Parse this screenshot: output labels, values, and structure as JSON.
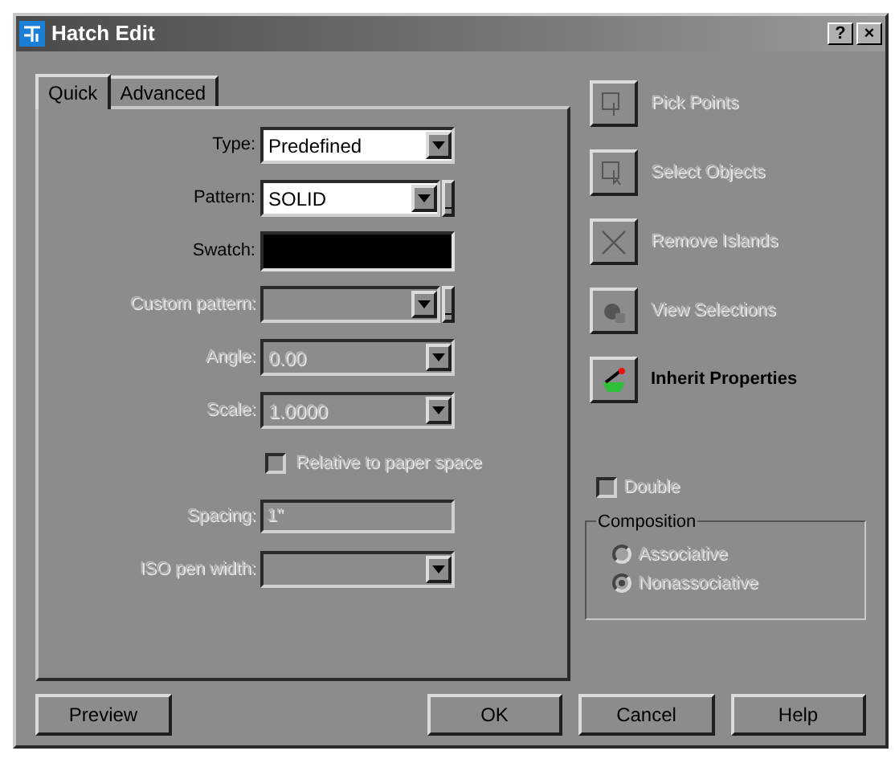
{
  "window": {
    "title": "Hatch Edit",
    "title_buttons": [
      "?",
      "×"
    ]
  },
  "tabs": [
    {
      "label": "Quick",
      "selected": true
    },
    {
      "label": "Advanced",
      "selected": false
    }
  ],
  "fields": [
    {
      "kind": "dropdown",
      "label": "Type:",
      "value": "Predefined",
      "disabled": false
    },
    {
      "kind": "browse",
      "label": "Pattern:",
      "value": "SOLID",
      "disabled": false
    },
    {
      "kind": "swatch",
      "label": "Swatch:",
      "disabled": false
    },
    {
      "kind": "browse",
      "label": "Custom pattern:",
      "disabled": true
    },
    {
      "kind": "dropdown",
      "label": "Angle:",
      "value": "0.00",
      "disabled": true
    },
    {
      "kind": "dropdown",
      "label": "Scale:",
      "value": "1.0000",
      "disabled": true
    },
    {
      "kind": "checkbox",
      "label": "Relative to paper space",
      "checked": false,
      "disabled": true
    },
    {
      "kind": "text",
      "label": "Spacing:",
      "value": "1\"",
      "disabled": true
    },
    {
      "kind": "dropdown",
      "label": "ISO pen width:",
      "disabled": true
    }
  ],
  "actions": [
    {
      "kind": "pick",
      "label": "Pick Points",
      "disabled": true
    },
    {
      "kind": "select",
      "label": "Select Objects",
      "disabled": true
    },
    {
      "kind": "remove",
      "label": "Remove Islands",
      "disabled": true
    },
    {
      "kind": "view",
      "label": "View Selections",
      "disabled": true
    },
    {
      "kind": "inherit",
      "label": "Inherit Properties",
      "disabled": false
    }
  ],
  "double": {
    "label": "Double",
    "checked": false,
    "disabled": true
  },
  "composition": {
    "title": "Composition",
    "options": [
      {
        "label": "Associative",
        "selected": false,
        "disabled": true
      },
      {
        "label": "Nonassociative",
        "selected": true,
        "disabled": true
      }
    ]
  },
  "buttons": [
    {
      "label": "Preview"
    },
    {
      "label": "OK"
    },
    {
      "label": "Cancel"
    },
    {
      "label": "Help"
    }
  ]
}
